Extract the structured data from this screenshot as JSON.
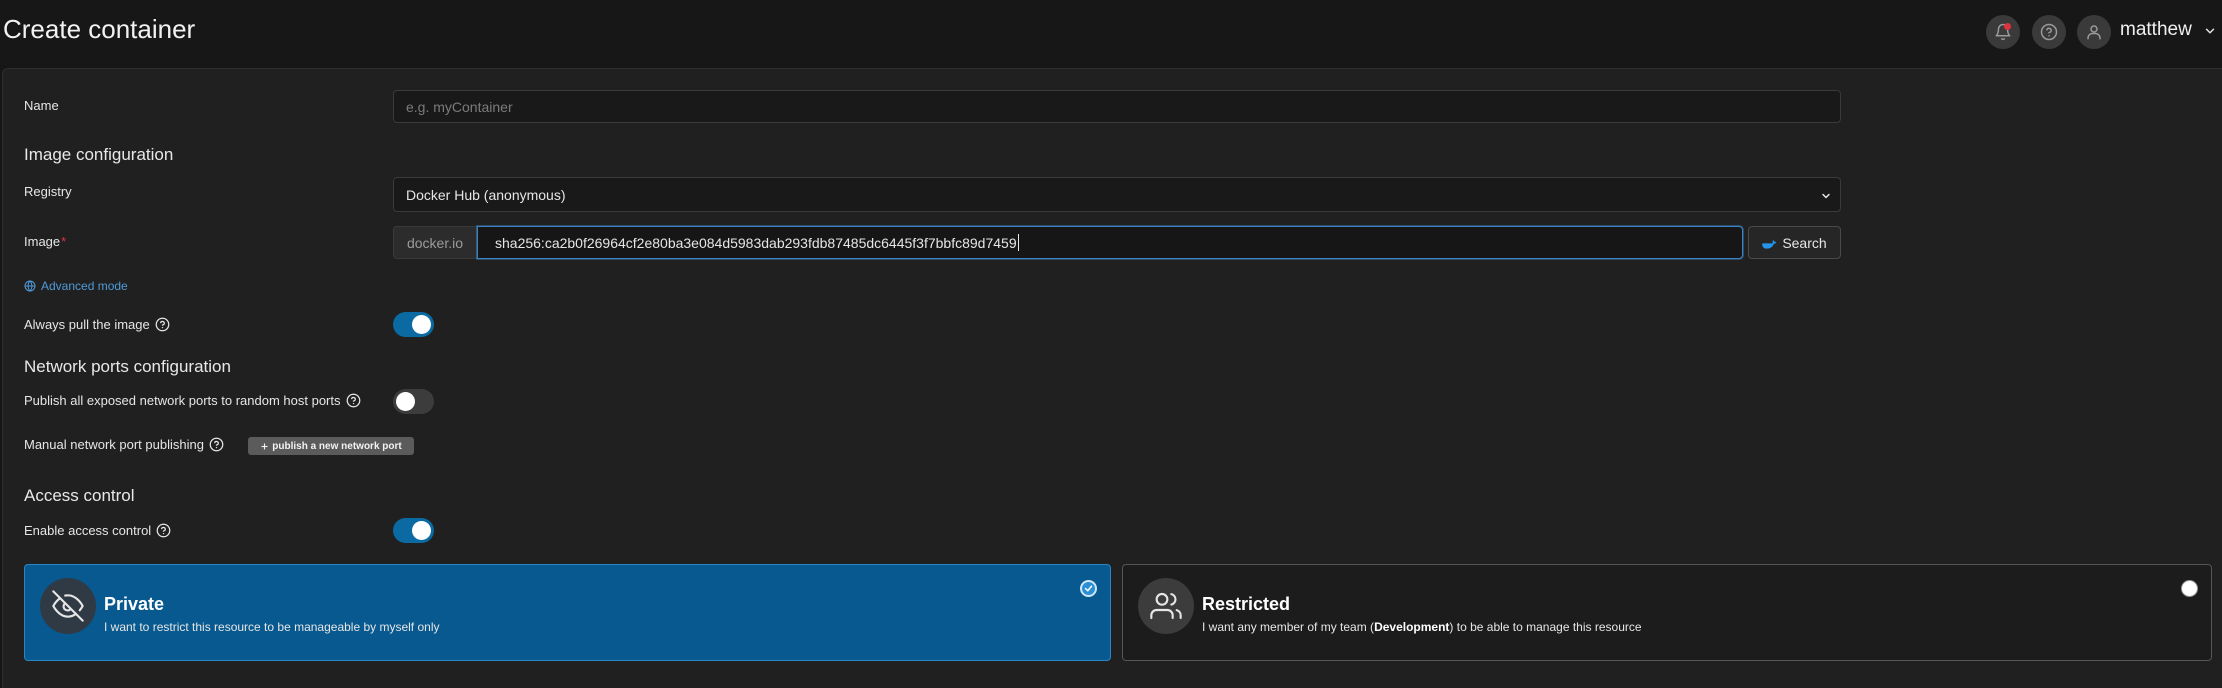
{
  "header": {
    "title": "Create container",
    "user_name": "matthew",
    "icons": [
      "bell-icon",
      "help-circle-icon",
      "user-icon",
      "chevron-down-icon"
    ]
  },
  "form": {
    "name": {
      "label": "Name",
      "value": "",
      "placeholder": "e.g. myContainer"
    },
    "image_section_title": "Image configuration",
    "registry": {
      "label": "Registry",
      "value": "Docker Hub (anonymous)"
    },
    "image": {
      "label": "Image",
      "required_mark": "*",
      "prefix": "docker.io",
      "value": "sha256:ca2b0f26964cf2e80ba3e084d5983dab293fdb87485dc6445f3f7bbfc89d7459",
      "search_label": "Search"
    },
    "advanced_mode_label": "Advanced mode",
    "always_pull": {
      "label": "Always pull the image",
      "enabled": true
    },
    "network_section_title": "Network ports configuration",
    "publish_all": {
      "label": "Publish all exposed network ports to random host ports",
      "enabled": false
    },
    "manual_publishing": {
      "label": "Manual network port publishing",
      "button_label": "publish a new network port"
    },
    "access_section_title": "Access control",
    "enable_access": {
      "label": "Enable access control",
      "enabled": true
    },
    "access_options": {
      "private": {
        "title": "Private",
        "description": "I want to restrict this resource to be manageable by myself only",
        "selected": true
      },
      "restricted": {
        "title": "Restricted",
        "description_before": "I want any member of my team (",
        "team": "Development",
        "description_after": ") to be able to manage this resource",
        "selected": false
      }
    }
  },
  "colors": {
    "accent": "#0b6aa2",
    "selected_card": "#08598f",
    "link": "#4f9ad8",
    "required": "#e0323c"
  }
}
